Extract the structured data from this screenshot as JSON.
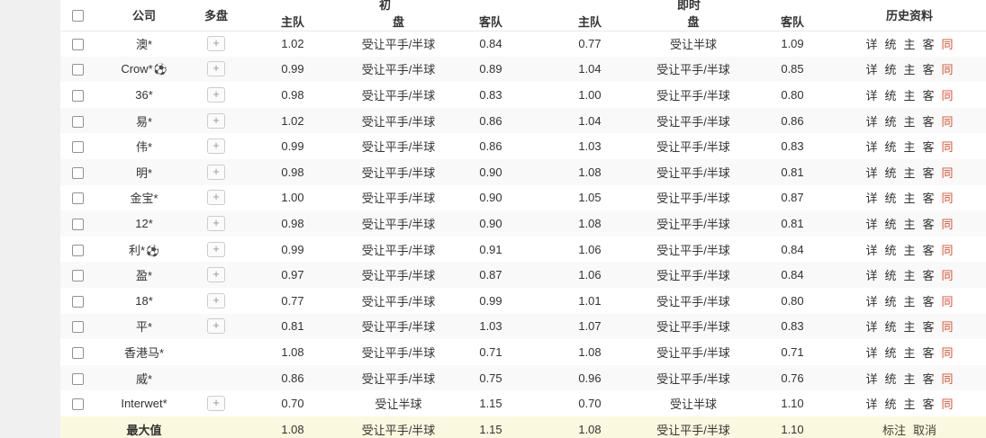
{
  "colors": {
    "highlight_red": "#dd4f2e",
    "footer_bg": "#fbf8e0",
    "gutter_gray": "#f0f0f0"
  },
  "icons": {
    "expand": "+",
    "soccer_ball": "⚽"
  },
  "header": {
    "company": "公司",
    "multi": "多盘",
    "group_initial": "初",
    "group_live": "即时",
    "home": "主队",
    "handicap": "盘",
    "away": "客队",
    "history": "历史资料"
  },
  "history_links": [
    "详",
    "统",
    "主",
    "客",
    "同"
  ],
  "rows": [
    {
      "company": "澳*",
      "ball": false,
      "multi": true,
      "init_home": "1.02",
      "init_line": "受让平手/半球",
      "init_away": "0.84",
      "live_home": "0.77",
      "live_line": "受让半球",
      "live_away": "1.09"
    },
    {
      "company": "Crow*",
      "ball": true,
      "multi": true,
      "init_home": "0.99",
      "init_line": "受让平手/半球",
      "init_away": "0.89",
      "live_home": "1.04",
      "live_line": "受让平手/半球",
      "live_away": "0.85"
    },
    {
      "company": "36*",
      "ball": false,
      "multi": true,
      "init_home": "0.98",
      "init_line": "受让平手/半球",
      "init_away": "0.83",
      "live_home": "1.00",
      "live_line": "受让平手/半球",
      "live_away": "0.80"
    },
    {
      "company": "易*",
      "ball": false,
      "multi": true,
      "init_home": "1.02",
      "init_line": "受让平手/半球",
      "init_away": "0.86",
      "live_home": "1.04",
      "live_line": "受让平手/半球",
      "live_away": "0.86"
    },
    {
      "company": "伟*",
      "ball": false,
      "multi": true,
      "init_home": "0.99",
      "init_line": "受让平手/半球",
      "init_away": "0.86",
      "live_home": "1.03",
      "live_line": "受让平手/半球",
      "live_away": "0.83"
    },
    {
      "company": "明*",
      "ball": false,
      "multi": true,
      "init_home": "0.98",
      "init_line": "受让平手/半球",
      "init_away": "0.90",
      "live_home": "1.08",
      "live_line": "受让平手/半球",
      "live_away": "0.81"
    },
    {
      "company": "金宝*",
      "ball": false,
      "multi": true,
      "init_home": "1.00",
      "init_line": "受让平手/半球",
      "init_away": "0.90",
      "live_home": "1.05",
      "live_line": "受让平手/半球",
      "live_away": "0.87"
    },
    {
      "company": "12*",
      "ball": false,
      "multi": true,
      "init_home": "0.98",
      "init_line": "受让平手/半球",
      "init_away": "0.90",
      "live_home": "1.08",
      "live_line": "受让平手/半球",
      "live_away": "0.81"
    },
    {
      "company": "利*",
      "ball": true,
      "multi": true,
      "init_home": "0.99",
      "init_line": "受让平手/半球",
      "init_away": "0.91",
      "live_home": "1.06",
      "live_line": "受让平手/半球",
      "live_away": "0.84"
    },
    {
      "company": "盈*",
      "ball": false,
      "multi": true,
      "init_home": "0.97",
      "init_line": "受让平手/半球",
      "init_away": "0.87",
      "live_home": "1.06",
      "live_line": "受让平手/半球",
      "live_away": "0.84"
    },
    {
      "company": "18*",
      "ball": false,
      "multi": true,
      "init_home": "0.77",
      "init_line": "受让平手/半球",
      "init_away": "0.99",
      "live_home": "1.01",
      "live_line": "受让平手/半球",
      "live_away": "0.80"
    },
    {
      "company": "平*",
      "ball": false,
      "multi": true,
      "init_home": "0.81",
      "init_line": "受让平手/半球",
      "init_away": "1.03",
      "live_home": "1.07",
      "live_line": "受让平手/半球",
      "live_away": "0.83"
    },
    {
      "company": "香港马*",
      "ball": false,
      "multi": false,
      "init_home": "1.08",
      "init_line": "受让平手/半球",
      "init_away": "0.71",
      "live_home": "1.08",
      "live_line": "受让平手/半球",
      "live_away": "0.71"
    },
    {
      "company": "威*",
      "ball": false,
      "multi": false,
      "init_home": "0.86",
      "init_line": "受让平手/半球",
      "init_away": "0.75",
      "live_home": "0.96",
      "live_line": "受让平手/半球",
      "live_away": "0.76"
    },
    {
      "company": "Interwet*",
      "ball": false,
      "multi": true,
      "init_home": "0.70",
      "init_line": "受让半球",
      "init_away": "1.15",
      "live_home": "0.70",
      "live_line": "受让半球",
      "live_away": "1.10"
    }
  ],
  "footer": {
    "label": "最大值",
    "init_home": "1.08",
    "init_line": "受让平手/半球",
    "init_away": "1.15",
    "live_home": "1.08",
    "live_line": "受让平手/半球",
    "live_away": "1.10",
    "mark": "标注",
    "cancel": "取消"
  }
}
